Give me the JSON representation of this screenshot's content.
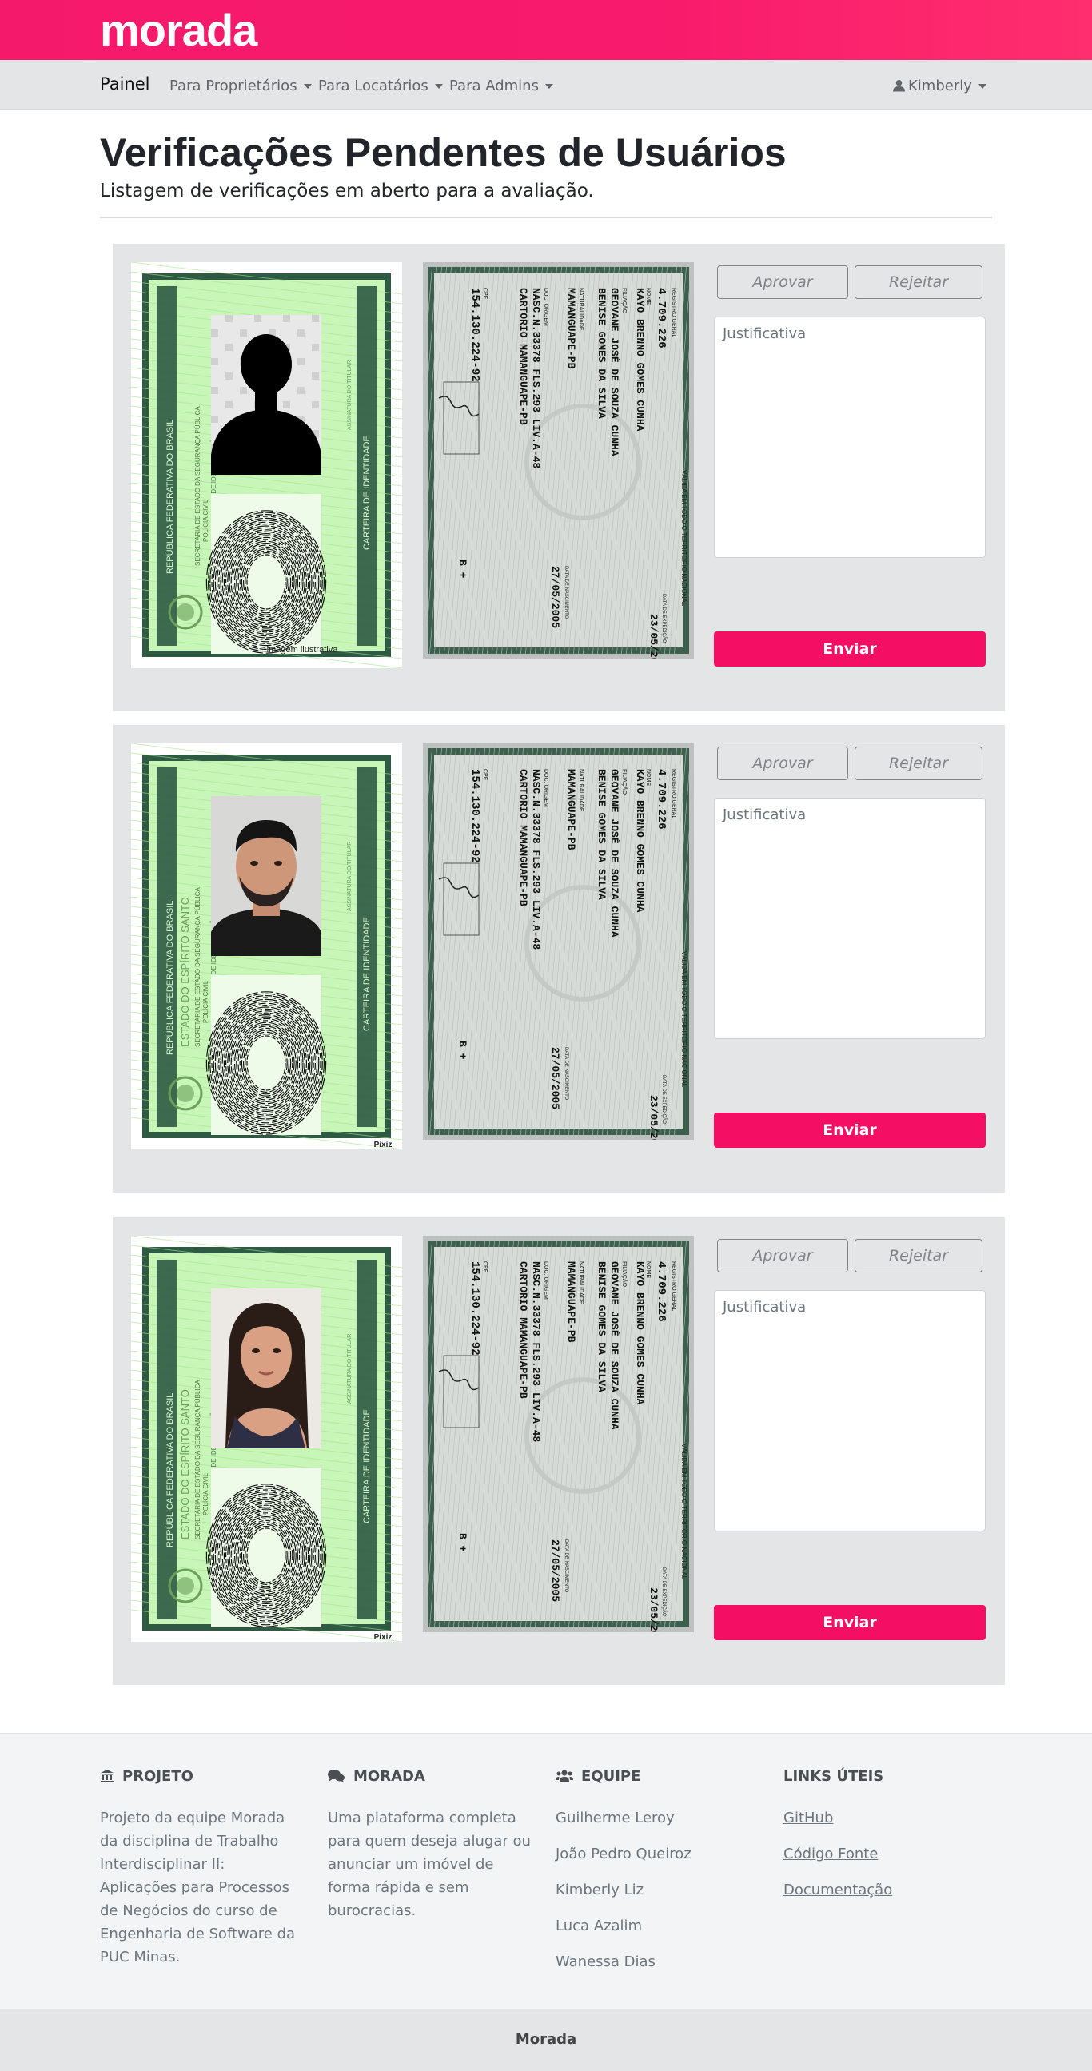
{
  "brand": "morada",
  "nav": {
    "home": "Painel",
    "items": [
      "Para Proprietários",
      "Para Locatários",
      "Para Admins"
    ],
    "user": "Kimberly"
  },
  "page": {
    "title": "Verificações Pendentes de Usuários",
    "subtitle": "Listagem de verificações em aberto para a avaliação."
  },
  "verifications": [
    {
      "photo": "silhouette",
      "front_caption": "imagem ilustrativa",
      "approve_label": "Aprovar",
      "reject_label": "Rejeitar",
      "justification_placeholder": "Justificativa",
      "send_label": "Enviar"
    },
    {
      "photo": "man",
      "front_caption": "Pixiz",
      "approve_label": "Aprovar",
      "reject_label": "Rejeitar",
      "justification_placeholder": "Justificativa",
      "send_label": "Enviar"
    },
    {
      "photo": "woman",
      "front_caption": "Pixiz",
      "approve_label": "Aprovar",
      "reject_label": "Rejeitar",
      "justification_placeholder": "Justificativa",
      "send_label": "Enviar"
    }
  ],
  "id_front": {
    "country": "REPÚBLICA FEDERATIVA DO BRASIL",
    "state": "ESTADO DO ESPÍRITO SANTO",
    "dept": "SECRETARIA DE ESTADO DA SEGURANÇA PÚBLICA",
    "police": "POLÍCIA CIVIL",
    "sptc": "SPTC / DEPARTAMENTO DE IDENTIFICAÇÃO",
    "card_label": "CARTEIRA DE IDENTIDADE",
    "signature_label": "ASSINATURA DO TITULAR"
  },
  "id_back": {
    "valid": "VÁLIDA EM TODO O TERRITÓRIO NACIONAL",
    "rg_label": "REGISTRO GERAL",
    "rg": "4.709.226",
    "issue_label": "DATA DE EXPEDIÇÃO",
    "issue_date": "23/05/2018",
    "name_label": "NOME",
    "name": "KAYO BRENNO GOMES CUNHA",
    "parents_label": "FILIAÇÃO",
    "father": "GEOVANE JOSÉ DE SOUZA CUNHA",
    "mother": "BENISE GOMES DA SILVA",
    "birthplace_label": "NATURALIDADE",
    "birthplace": "MAMANGUAPE-PB",
    "birth_label": "DATA DE NASCIMENTO",
    "birth_date": "27/05/2005",
    "origin_label": "DOC. ORIGEM",
    "origin1": "NASC.N.33378 FLS.293 LIV.A-48",
    "origin2": "CARTORIO MAMANGUAPE-PB",
    "cpf_label": "CPF",
    "cpf": "154.130.224-92",
    "blood": "B +"
  },
  "footer": {
    "projeto": {
      "title": "PROJETO",
      "text": "Projeto da equipe Morada da disciplina de Trabalho Interdisciplinar II: Aplicações para Processos de Negócios do curso de Engenharia de Software da PUC Minas."
    },
    "morada": {
      "title": "MORADA",
      "text": "Uma plataforma completa para quem deseja alugar ou anunciar um imóvel de forma rápida e sem burocracias."
    },
    "equipe": {
      "title": "EQUIPE",
      "members": [
        "Guilherme Leroy",
        "João Pedro Queiroz",
        "Kimberly Liz",
        "Luca Azalim",
        "Wanessa Dias"
      ]
    },
    "links": {
      "title": "LINKS ÚTEIS",
      "items": [
        "GitHub",
        "Código Fonte",
        "Documentação"
      ]
    },
    "bottom": "Morada"
  },
  "colors": {
    "brand": "#f50f64",
    "nav_bg": "#e4e5e7",
    "card_bg": "#e4e5e7",
    "id_green": "#b6f0a6",
    "id_frame": "#2e5a44"
  }
}
